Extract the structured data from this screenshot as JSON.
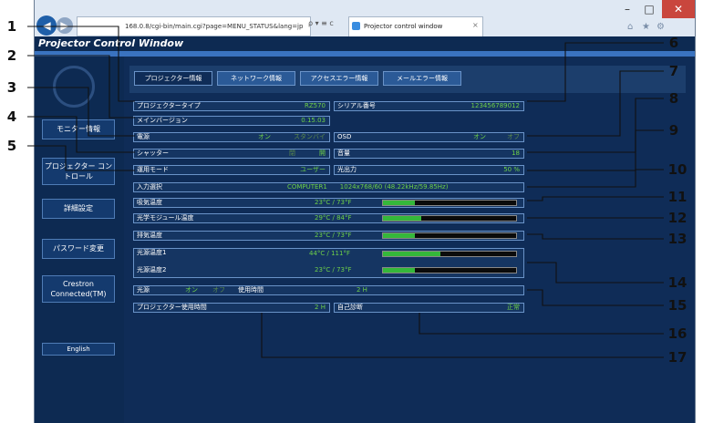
{
  "browser": {
    "address": "168.0.8/cgi-bin/main.cgi?page=MENU_STATUS&lang=jp",
    "tab_title": "Projector control window",
    "addr_icons": "ρ ▾ ≡ c"
  },
  "page": {
    "title": "Projector Control Window"
  },
  "sidebar": {
    "items": [
      {
        "label": "モニター情報"
      },
      {
        "label": "プロジェクター コントロール"
      },
      {
        "label": "詳細設定"
      },
      {
        "label": "パスワード変更"
      },
      {
        "label": "Crestron Connected(TM)"
      }
    ],
    "english_label": "English"
  },
  "tabs": [
    "プロジェクター情報",
    "ネットワーク情報",
    "アクセスエラー情報",
    "メールエラー情報"
  ],
  "status": {
    "projector_type": {
      "label": "プロジェクタータイプ",
      "value": "RZ570"
    },
    "serial": {
      "label": "シリアル番号",
      "value": "123456789012"
    },
    "main_version": {
      "label": "メインバージョン",
      "value": "0.15.03"
    },
    "power": {
      "label": "電源",
      "on": "オン",
      "standby": "スタンバイ"
    },
    "osd": {
      "label": "OSD",
      "on": "オン",
      "off": "オフ"
    },
    "shutter": {
      "label": "シャッター",
      "closed": "閉",
      "open": "開"
    },
    "volume": {
      "label": "音量",
      "value": "18"
    },
    "run_mode": {
      "label": "運用モード",
      "value": "ユーザー"
    },
    "light_output": {
      "label": "光出力",
      "value": "50 %"
    },
    "input": {
      "label": "入力選択",
      "value": "COMPUTER1　　1024x768/60 (48.22kHz/59.85Hz)"
    },
    "intake_temp": {
      "label": "吸気温度",
      "value": "23°C / 73°F",
      "level": 0.24
    },
    "optical_temp": {
      "label": "光学モジュール温度",
      "value": "29°C / 84°F",
      "level": 0.29
    },
    "exhaust_temp": {
      "label": "排気温度",
      "value": "23°C / 73°F",
      "level": 0.24
    },
    "light_temp1": {
      "label": "光源温度1",
      "value": "44°C / 111°F",
      "level": 0.43
    },
    "light_temp2": {
      "label": "光源温度2",
      "value": "23°C / 73°F",
      "level": 0.24
    },
    "light_source": {
      "label": "光源",
      "on": "オン",
      "off": "オフ",
      "hours_label": "使用時間",
      "hours": "2 H"
    },
    "proj_hours": {
      "label": "プロジェクター使用時間",
      "value": "2 H"
    },
    "self_diag": {
      "label": "自己診断",
      "value": "正常"
    }
  },
  "callouts": [
    "1",
    "2",
    "3",
    "4",
    "5",
    "6",
    "7",
    "8",
    "9",
    "10",
    "11",
    "12",
    "13",
    "14",
    "15",
    "16",
    "17"
  ]
}
